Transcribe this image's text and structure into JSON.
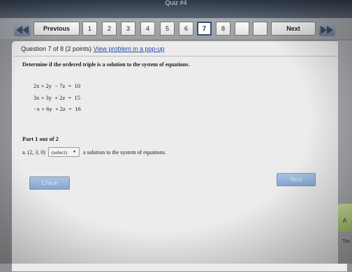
{
  "quiz_title": "Quiz #4",
  "nav": {
    "previous_label": "Previous",
    "next_label": "Next",
    "question_numbers": [
      "1",
      "2",
      "3",
      "4",
      "5",
      "6",
      "7",
      "8"
    ],
    "current_question": "7"
  },
  "question": {
    "header": "Question 7 of 8 (2 points)",
    "popup_link": "View problem in a pop-up",
    "instruction": "Determine if the ordered triple is a solution to the system of equations.",
    "equations": [
      "2x + 2y  − 7z  =  10",
      "3x + 3y  + 2z  =  15",
      "−x + 6y  + 2z  =  16"
    ],
    "part_label": "Part 1 out of 2",
    "part_prefix": "a. (2, 3, 0)",
    "select_value": "(select)",
    "part_suffix": "a solution to the system of equations."
  },
  "buttons": {
    "check": "Check",
    "next": "Next"
  },
  "side": {
    "tab_letter": "A",
    "tab_label": "Tim"
  }
}
